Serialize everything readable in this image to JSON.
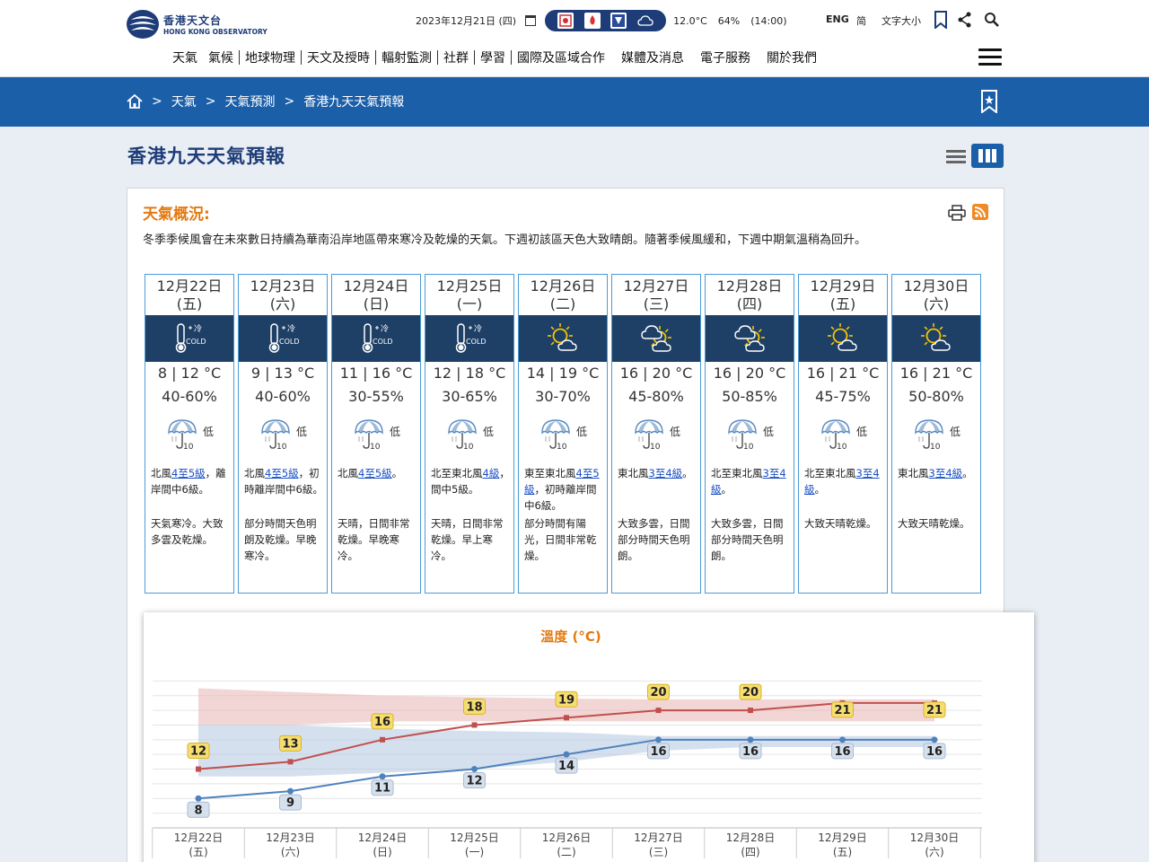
{
  "header": {
    "logo_zh": "香港天文台",
    "logo_en": "HONG KONG OBSERVATORY",
    "date": "2023年12月21日 (四)",
    "temperature": "12.0°C",
    "humidity": "64%",
    "time": "(14:00)",
    "lang_eng": "ENG",
    "lang_sc": "简",
    "font_size": "文字大小"
  },
  "nav": [
    "天氣",
    "氣候",
    "地球物理",
    "天文及授時",
    "輻射監測",
    "社群",
    "學習",
    "國際及區域合作",
    "媒體及消息",
    "電子服務",
    "關於我們"
  ],
  "breadcrumb": {
    "sep": ">",
    "items": [
      "天氣",
      "天氣預測",
      "香港九天天氣預報"
    ]
  },
  "page_title": "香港九天天氣預報",
  "general": {
    "title": "天氣概況:",
    "text": "冬季季候風會在未來數日持續為華南沿岸地區帶來寒冷及乾燥的天氣。下週初該區天色大致晴朗。隨著季候風緩和，下週中期氣溫稍為回升。"
  },
  "days": [
    {
      "date": "12月22日",
      "dow": "(五)",
      "icon": "cold",
      "temp": "8 | 12 °C",
      "psr_range": "40-60%",
      "psr_label": "低",
      "wind_pre": "北風",
      "wind_link": "4至5級",
      "wind_post": "，離岸間中6級。",
      "desc": "天氣寒冷。大致多雲及乾燥。"
    },
    {
      "date": "12月23日",
      "dow": "(六)",
      "icon": "cold",
      "temp": "9 | 13 °C",
      "psr_range": "40-60%",
      "psr_label": "低",
      "wind_pre": "北風",
      "wind_link": "4至5級",
      "wind_post": "，初時離岸間中6級。",
      "desc": "部分時間天色明朗及乾燥。早晚寒冷。"
    },
    {
      "date": "12月24日",
      "dow": "(日)",
      "icon": "cold",
      "temp": "11 | 16 °C",
      "psr_range": "30-55%",
      "psr_label": "低",
      "wind_pre": "北風",
      "wind_link": "4至5級",
      "wind_post": "。",
      "desc": "天晴，日間非常乾燥。早晚寒冷。"
    },
    {
      "date": "12月25日",
      "dow": "(一)",
      "icon": "cold",
      "temp": "12 | 18 °C",
      "psr_range": "30-65%",
      "psr_label": "低",
      "wind_pre": "北至東北風",
      "wind_link": "4級",
      "wind_post": "，間中5級。",
      "desc": "天晴，日間非常乾燥。早上寒冷。"
    },
    {
      "date": "12月26日",
      "dow": "(二)",
      "icon": "sunny-cloud",
      "temp": "14 | 19 °C",
      "psr_range": "30-70%",
      "psr_label": "低",
      "wind_pre": "東至東北風",
      "wind_link": "4至5級",
      "wind_post": "，初時離岸間中6級。",
      "desc": "部分時間有陽光，日間非常乾燥。"
    },
    {
      "date": "12月27日",
      "dow": "(三)",
      "icon": "cloud-sun",
      "temp": "16 | 20 °C",
      "psr_range": "45-80%",
      "psr_label": "低",
      "wind_pre": "東北風",
      "wind_link": "3至4級",
      "wind_post": "。",
      "desc": "大致多雲，日間部分時間天色明朗。"
    },
    {
      "date": "12月28日",
      "dow": "(四)",
      "icon": "cloud-sun",
      "temp": "16 | 20 °C",
      "psr_range": "50-85%",
      "psr_label": "低",
      "wind_pre": "北至東北風",
      "wind_link": "3至4級",
      "wind_post": "。",
      "desc": "大致多雲，日間部分時間天色明朗。"
    },
    {
      "date": "12月29日",
      "dow": "(五)",
      "icon": "sunny-cloud",
      "temp": "16 | 21 °C",
      "psr_range": "45-75%",
      "psr_label": "低",
      "wind_pre": "北至東北風",
      "wind_link": "3至4級",
      "wind_post": "。",
      "desc": "大致天晴乾燥。"
    },
    {
      "date": "12月30日",
      "dow": "(六)",
      "icon": "sunny-cloud",
      "temp": "16 | 21 °C",
      "psr_range": "50-80%",
      "psr_label": "低",
      "wind_pre": "東北風",
      "wind_link": "3至4級",
      "wind_post": "。",
      "desc": "大致天晴乾燥。"
    }
  ],
  "colors": {
    "brand": "#1b5fa8",
    "accent": "#e27a11",
    "max_line": "#c0504d",
    "min_line": "#4f81bd"
  },
  "chart_data": {
    "type": "line",
    "title": "溫度 (°C)",
    "categories": [
      "12月22日",
      "12月23日",
      "12月24日",
      "12月25日",
      "12月26日",
      "12月27日",
      "12月28日",
      "12月29日",
      "12月30日"
    ],
    "category_sub": [
      "(五)",
      "(六)",
      "(日)",
      "(一)",
      "(二)",
      "(三)",
      "(四)",
      "(五)",
      "(六)"
    ],
    "series": [
      {
        "name": "max",
        "values": [
          12,
          13,
          16,
          18,
          19,
          20,
          20,
          21,
          21
        ],
        "color": "#c0504d"
      },
      {
        "name": "min",
        "values": [
          8,
          9,
          11,
          12,
          14,
          16,
          16,
          16,
          16
        ],
        "color": "#4f81bd"
      }
    ],
    "ranges": [
      {
        "name": "max_normal",
        "lower": [
          18,
          18,
          18.5,
          18.5,
          18.5,
          18.5,
          18.5,
          18.5,
          18.5
        ],
        "upper": [
          23,
          22.5,
          22,
          21.8,
          21.6,
          21.5,
          21.5,
          21.5,
          21.5
        ],
        "color": "#e8b5b5"
      },
      {
        "name": "min_normal",
        "lower": [
          11,
          11,
          11.5,
          12,
          13,
          14.5,
          15,
          15,
          15
        ],
        "upper": [
          18,
          18,
          17.5,
          17.2,
          17,
          16.5,
          16.5,
          16.5,
          16.5
        ],
        "color": "#b3c6e0"
      }
    ],
    "ylim": [
      4,
      26
    ],
    "grid": true
  }
}
